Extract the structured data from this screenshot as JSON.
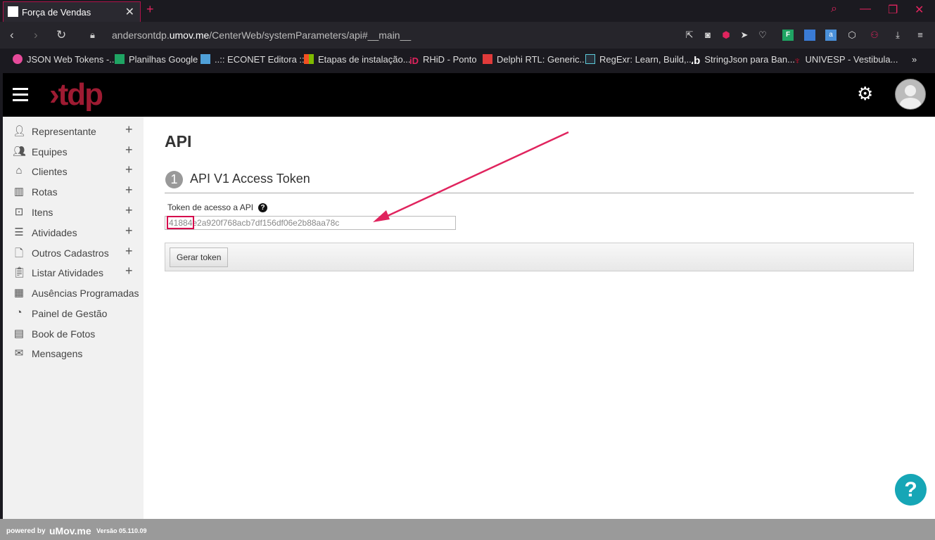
{
  "browser": {
    "tab_title": "Força de Vendas",
    "url_prefix": "andersontdp.",
    "url_domain": "umov.me",
    "url_path": "/CenterWeb/systemParameters/api#__main__",
    "bookmarks": [
      {
        "label": "JSON Web Tokens -...",
        "color": "#e64a9a"
      },
      {
        "label": "Planilhas Google",
        "color": "#1fa463"
      },
      {
        "label": "..:: ECONET Editora ::..",
        "color": "#4fa0d8"
      },
      {
        "label": "Etapas de instalação...",
        "color": "#f25022"
      },
      {
        "label": "RHiD - Ponto",
        "color": "#e0245e"
      },
      {
        "label": "Delphi RTL: Generic...",
        "color": "#e03a3a"
      },
      {
        "label": "RegExr: Learn, Build,...",
        "color": "#5cc9d8"
      },
      {
        "label": "StringJson para Ban...",
        "color": "#ffffff"
      },
      {
        "label": "UNIVESP - Vestibula...",
        "color": "#c8102e"
      }
    ],
    "more_bookmarks": "»"
  },
  "header": {
    "logo_text": "›tdp",
    "settings_icon": "gear-icon"
  },
  "sidebar": {
    "items": [
      {
        "label": "Representante",
        "icon": "user-icon",
        "expandable": "+"
      },
      {
        "label": "Equipes",
        "icon": "users-icon",
        "expandable": "+"
      },
      {
        "label": "Clientes",
        "icon": "home-icon",
        "expandable": "+"
      },
      {
        "label": "Rotas",
        "icon": "map-icon",
        "expandable": "+"
      },
      {
        "label": "Itens",
        "icon": "box-icon",
        "expandable": "+"
      },
      {
        "label": "Atividades",
        "icon": "list-icon",
        "expandable": "+"
      },
      {
        "label": "Outros Cadastros",
        "icon": "file-icon",
        "expandable": "+"
      },
      {
        "label": "Listar Atividades",
        "icon": "clipboard-icon",
        "expandable": "+"
      },
      {
        "label": "Ausências Programadas",
        "icon": "calendar-icon",
        "expandable": ""
      },
      {
        "label": "Painel de Gestão",
        "icon": "dashboard-icon",
        "expandable": ""
      },
      {
        "label": "Book de Fotos",
        "icon": "book-icon",
        "expandable": ""
      },
      {
        "label": "Mensagens",
        "icon": "envelope-icon",
        "expandable": ""
      }
    ]
  },
  "main": {
    "page_title": "API",
    "section_number": "1",
    "section_title": "API V1 Access Token",
    "token_label": "Token de acesso a API",
    "token_value": "41884e2a920f768acb7df156df06e2b88aa78c",
    "generate_button": "Gerar token",
    "help_bubble": "?"
  },
  "footer": {
    "powered_by": "powered by",
    "brand": "uMov.me",
    "version": "Versão 05.110.09"
  },
  "colors": {
    "accent": "#e0245e",
    "logo": "#9e1b32",
    "help_bubble": "#16a6b6"
  }
}
